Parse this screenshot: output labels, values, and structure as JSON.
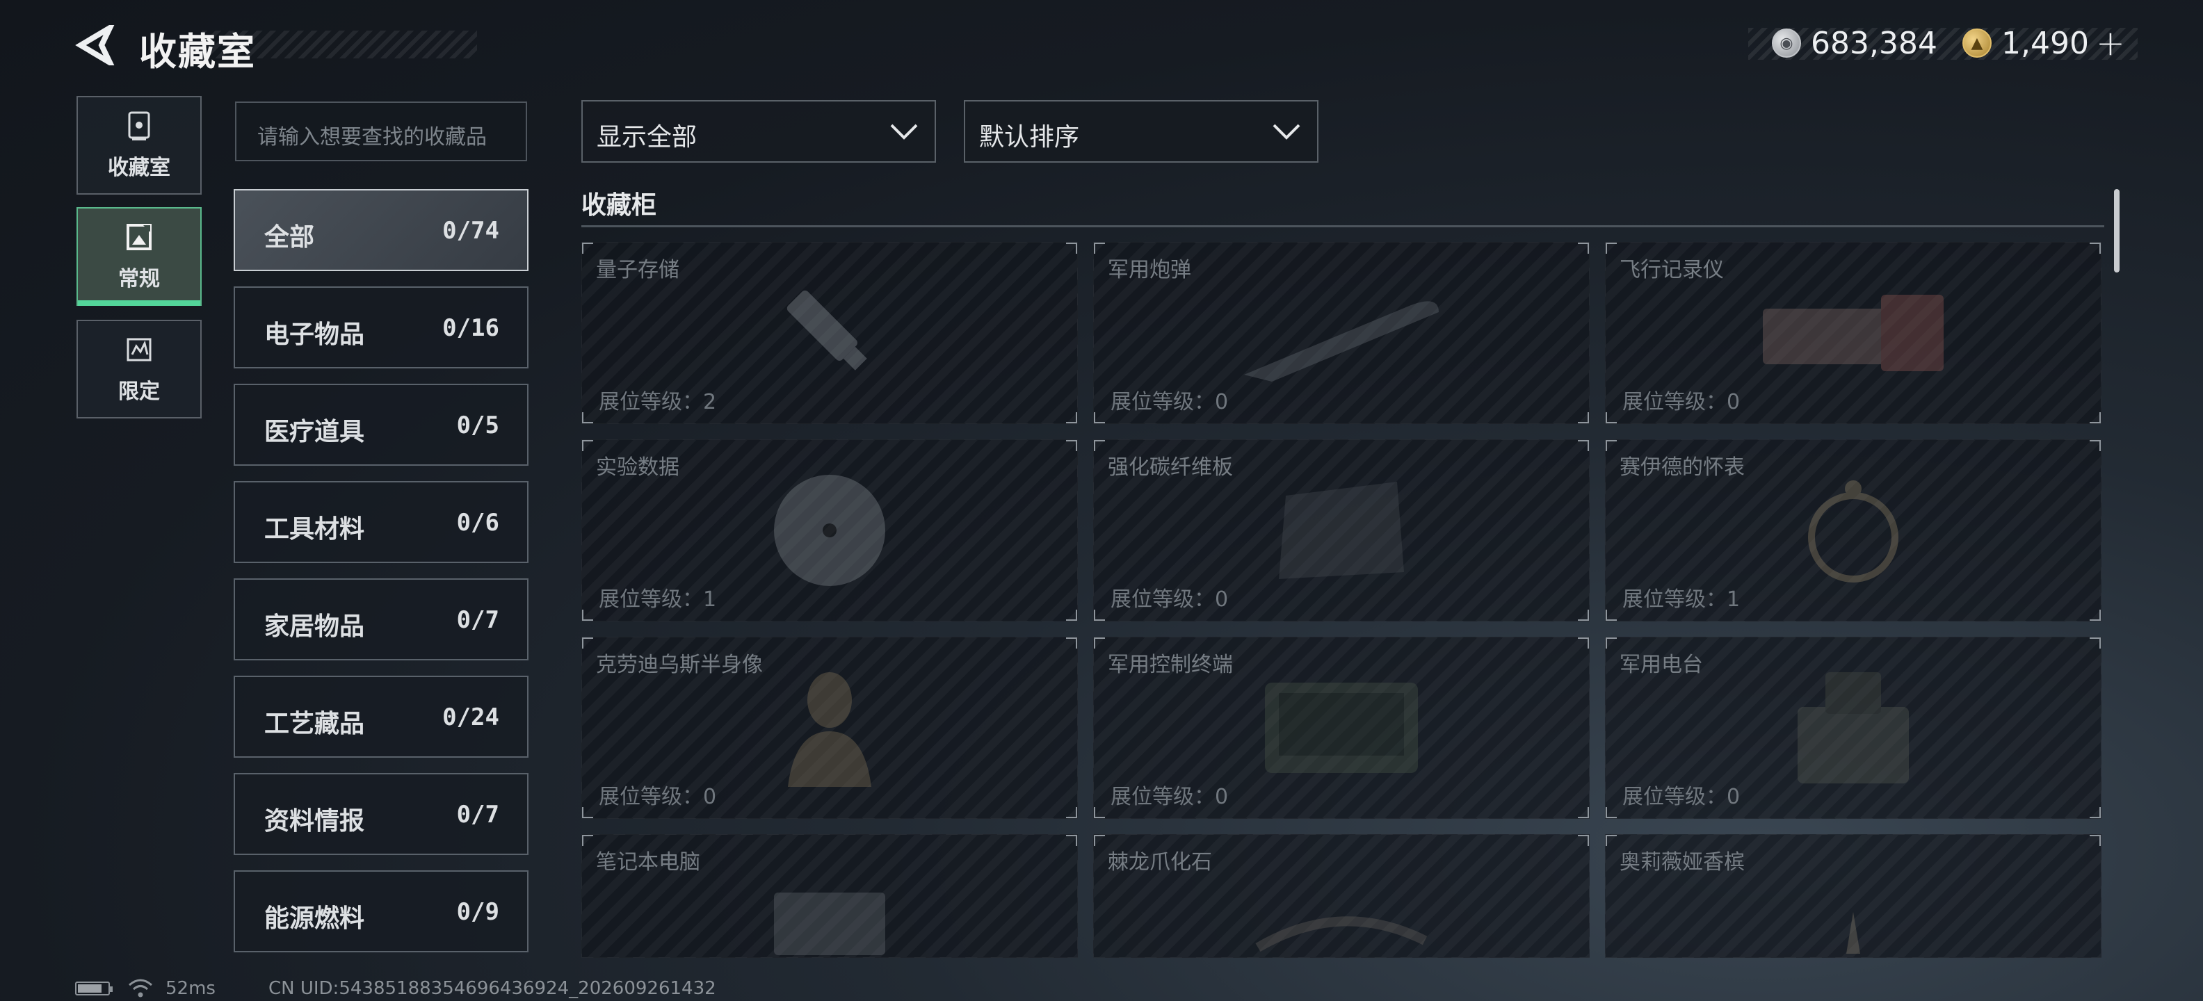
{
  "header": {
    "title": "收藏室",
    "currency": [
      {
        "icon": "silver-coin-icon",
        "value": "683,384"
      },
      {
        "icon": "gold-coin-icon",
        "value": "1,490"
      }
    ]
  },
  "side_tabs": [
    {
      "label": "收藏室",
      "icon": "vault-icon",
      "active": false
    },
    {
      "label": "常规",
      "icon": "image-frame-icon",
      "active": true
    },
    {
      "label": "限定",
      "icon": "limited-icon",
      "active": false
    }
  ],
  "search": {
    "placeholder": "请输入想要查找的收藏品"
  },
  "categories": [
    {
      "label": "全部",
      "count": "0/74",
      "active": true
    },
    {
      "label": "电子物品",
      "count": "0/16"
    },
    {
      "label": "医疗道具",
      "count": "0/5"
    },
    {
      "label": "工具材料",
      "count": "0/6"
    },
    {
      "label": "家居物品",
      "count": "0/7"
    },
    {
      "label": "工艺藏品",
      "count": "0/24"
    },
    {
      "label": "资料情报",
      "count": "0/7"
    },
    {
      "label": "能源燃料",
      "count": "0/9"
    }
  ],
  "filters": {
    "display": "显示全部",
    "sort": "默认排序"
  },
  "section": {
    "title": "收藏柜"
  },
  "items": [
    {
      "name": "量子存储",
      "level": "展位等级：2"
    },
    {
      "name": "军用炮弹",
      "level": "展位等级：0"
    },
    {
      "name": "飞行记录仪",
      "level": "展位等级：0"
    },
    {
      "name": "实验数据",
      "level": "展位等级：1"
    },
    {
      "name": "强化碳纤维板",
      "level": "展位等级：0"
    },
    {
      "name": "赛伊德的怀表",
      "level": "展位等级：1"
    },
    {
      "name": "克劳迪乌斯半身像",
      "level": "展位等级：0"
    },
    {
      "name": "军用控制终端",
      "level": "展位等级：0"
    },
    {
      "name": "军用电台",
      "level": "展位等级：0"
    },
    {
      "name": "笔记本电脑",
      "level": ""
    },
    {
      "name": "棘龙爪化石",
      "level": ""
    },
    {
      "name": "奥莉薇娅香槟",
      "level": ""
    }
  ],
  "status": {
    "latency": "52ms",
    "uid": "CN UID:5438518835469643692‌4_202609261432"
  }
}
